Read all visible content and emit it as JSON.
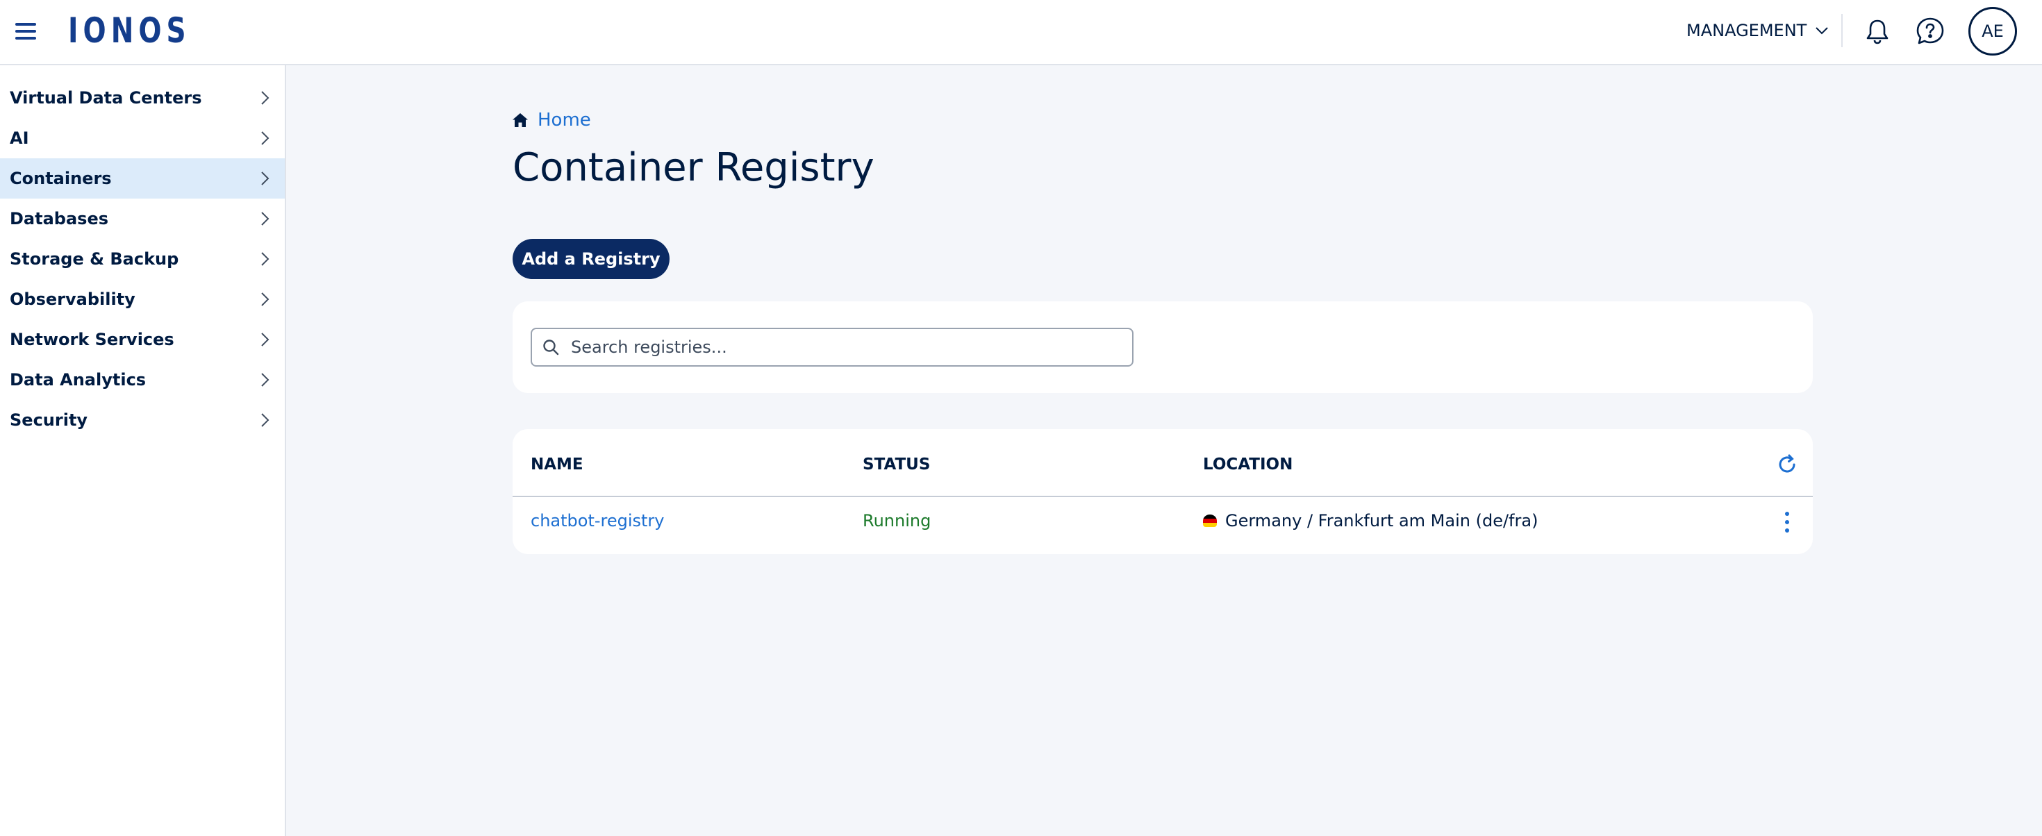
{
  "header": {
    "logo": "IONOS",
    "management_label": "MANAGEMENT",
    "avatar_initials": "AE"
  },
  "sidebar": {
    "items": [
      {
        "label": "Virtual Data Centers",
        "active": false
      },
      {
        "label": "AI",
        "active": false
      },
      {
        "label": "Containers",
        "active": true
      },
      {
        "label": "Databases",
        "active": false
      },
      {
        "label": "Storage & Backup",
        "active": false
      },
      {
        "label": "Observability",
        "active": false
      },
      {
        "label": "Network Services",
        "active": false
      },
      {
        "label": "Data Analytics",
        "active": false
      },
      {
        "label": "Security",
        "active": false
      }
    ]
  },
  "breadcrumb": {
    "home_label": "Home"
  },
  "page": {
    "title": "Container Registry",
    "add_button_label": "Add a Registry"
  },
  "search": {
    "placeholder": "Search registries...",
    "value": ""
  },
  "table": {
    "columns": {
      "name": "NAME",
      "status": "STATUS",
      "location": "LOCATION"
    },
    "rows": [
      {
        "name": "chatbot-registry",
        "status": "Running",
        "location": "Germany / Frankfurt am Main (de/fra)"
      }
    ]
  },
  "colors": {
    "brand": "#143d8c",
    "primary_button": "#0b2a63",
    "link": "#1d6fd1",
    "status_running": "#1c7a2b",
    "active_nav_bg": "#dcebfa",
    "page_bg": "#f4f6fa"
  },
  "icons": {
    "menu": "hamburger-icon",
    "management_dropdown": "chevron-down-icon",
    "notifications": "bell-icon",
    "help": "help-bubble-icon",
    "nav_arrow": "chevron-right-icon",
    "home": "home-icon",
    "search": "search-icon",
    "refresh": "refresh-icon",
    "row_actions": "kebab-menu-icon",
    "location_flag": "germany-flag-icon"
  }
}
